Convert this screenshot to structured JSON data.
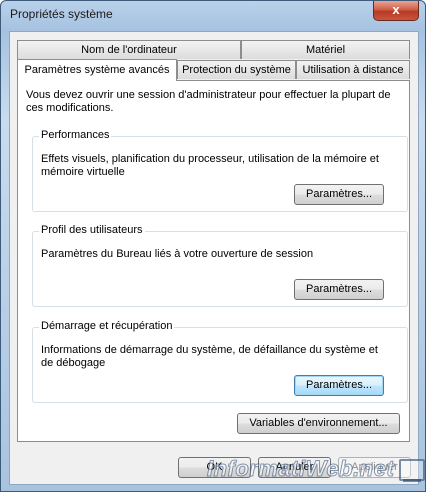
{
  "window": {
    "title": "Propriétés système",
    "close_glyph": "x"
  },
  "tabs_row1": [
    {
      "label": "Nom de l'ordinateur"
    },
    {
      "label": "Matériel"
    }
  ],
  "tabs_row2": [
    {
      "label": "Paramètres système avancés",
      "active": true
    },
    {
      "label": "Protection du système"
    },
    {
      "label": "Utilisation à distance"
    }
  ],
  "intro": "Vous devez ouvrir une session d'administrateur pour effectuer la plupart de ces modifications.",
  "performances": {
    "label": "Performances",
    "text": "Effets visuels, planification du processeur, utilisation de la mémoire et mémoire virtuelle",
    "button": "Paramètres..."
  },
  "profil": {
    "label": "Profil des utilisateurs",
    "text": "Paramètres du Bureau liés à votre ouverture de session",
    "button": "Paramètres..."
  },
  "demarrage": {
    "label": "Démarrage et récupération",
    "text": "Informations de démarrage du système, de défaillance du système et de débogage",
    "button": "Paramètres..."
  },
  "env_button": "Variables d'environnement...",
  "footer": {
    "ok": "OK",
    "cancel": "Annuler",
    "apply": "Appliquer"
  },
  "watermark": {
    "text": "InformatiWeb.net",
    "icon": "laptop-icon"
  }
}
